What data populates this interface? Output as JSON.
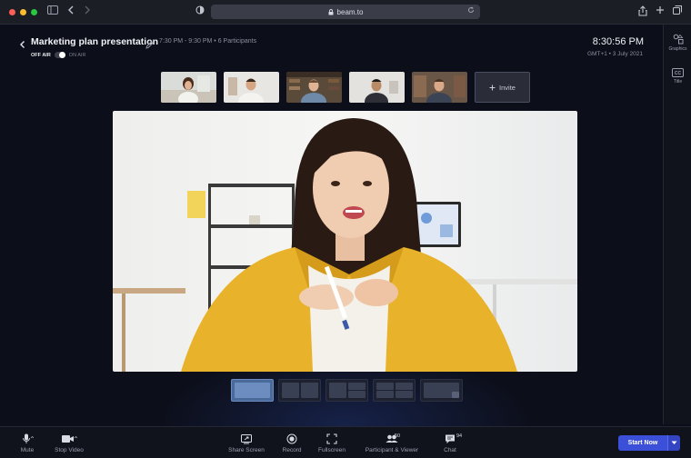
{
  "browser": {
    "url": "beam.to"
  },
  "header": {
    "title": "Marketing plan presentation",
    "meta": "7:30 PM - 9:30 PM • 6 Participants",
    "off_air_label": "OFF AIR",
    "on_air_label": "ON AIR",
    "clock": "8:30:56 PM",
    "timezone": "GMT+1 • 3 July 2021"
  },
  "right_sidebar": {
    "items": [
      {
        "label": "Graphics",
        "icon": "graphics-icon"
      },
      {
        "label": "Title",
        "icon": "cc-icon"
      }
    ]
  },
  "participants": {
    "invite_label": "Invite",
    "thumbnails": [
      {
        "icon": "participant-woman"
      },
      {
        "icon": "participant-man-1"
      },
      {
        "icon": "participant-man-2"
      },
      {
        "icon": "participant-man-3"
      },
      {
        "icon": "participant-man-4"
      }
    ]
  },
  "toolbar": {
    "mute_label": "Mute",
    "stop_video_label": "Stop Video",
    "share_screen_label": "Share Screen",
    "record_label": "Record",
    "fullscreen_label": "Fullscreen",
    "participant_viewer_label": "Participant & Viewer",
    "participant_count": "50",
    "chat_label": "Chat",
    "chat_count": "94",
    "start_now_label": "Start Now"
  },
  "colors": {
    "accent": "#3b4fd8",
    "background": "#0c0e19",
    "selected_layout": "#4a6a9a"
  }
}
